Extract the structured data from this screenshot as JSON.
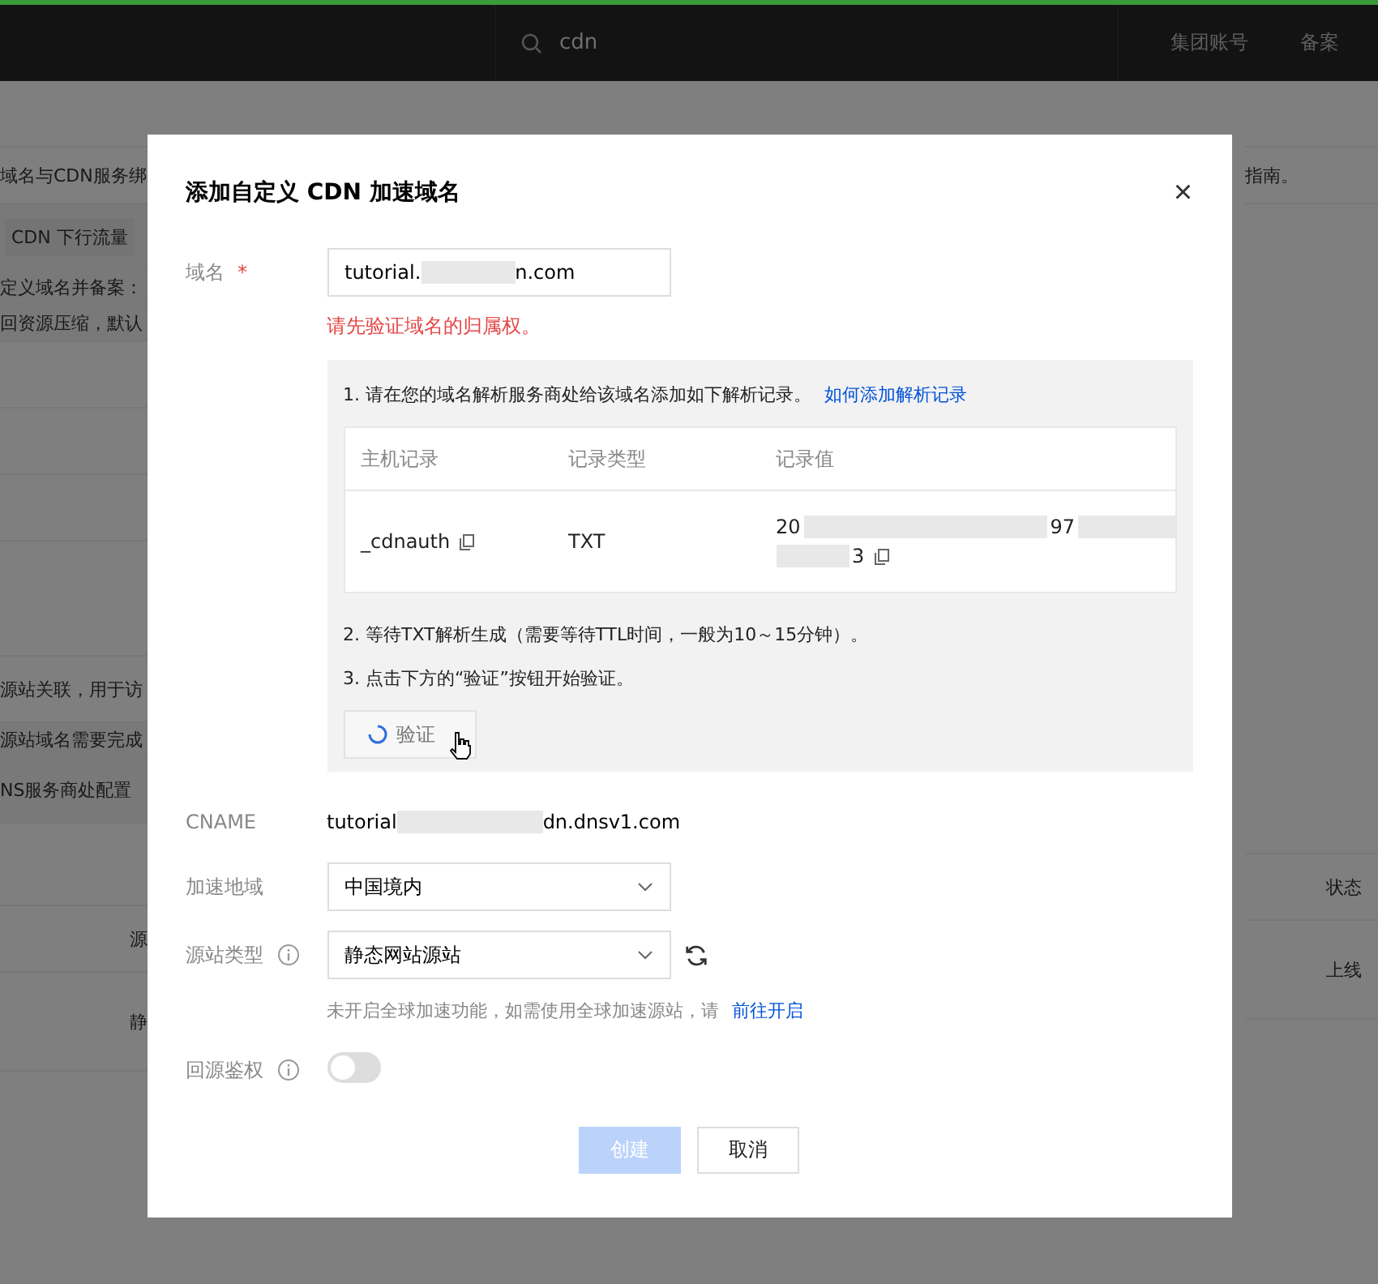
{
  "header": {
    "search_value": "cdn",
    "nav": [
      "集团账号",
      "备案"
    ]
  },
  "background": {
    "left": [
      "域名与CDN服务绑",
      "CDN 下行流量",
      "定义域名并备案：",
      "回资源压缩，默认",
      "源站关联，用于访",
      "源站域名需要完成",
      "NS服务商处配置",
      "源",
      "静"
    ],
    "right": [
      "指南。",
      "状态",
      "上线"
    ]
  },
  "dialog": {
    "title": "添加自定义 CDN 加速域名",
    "close": "×",
    "domain": {
      "label": "域名",
      "required_mark": "*",
      "value_start": "tutorial.",
      "value_end": "n.com",
      "error": "请先验证域名的归属权。"
    },
    "verify": {
      "step1": "1. 请在您的域名解析服务商处给该域名添加如下解析记录。",
      "help_link": "如何添加解析记录",
      "columns": [
        "主机记录",
        "记录类型",
        "记录值"
      ],
      "record": {
        "host": "_cdnauth",
        "type": "TXT",
        "value_start": "20",
        "value_mid": "97",
        "value_end": "3"
      },
      "step2": "2. 等待TXT解析生成（需要等待TTL时间，一般为10～15分钟）。",
      "step3": "3. 点击下方的“验证”按钮开始验证。",
      "button": {
        "label": "验证",
        "loading": true
      }
    },
    "cname": {
      "label": "CNAME",
      "value_start": "tutorial",
      "value_end": "dn.dnsv1.com"
    },
    "region": {
      "label": "加速地域",
      "value": "中国境内"
    },
    "origin": {
      "label": "源站类型",
      "value": "静态网站源站",
      "hint": "未开启全球加速功能，如需使用全球加速源站，请",
      "hint_link": "前往开启"
    },
    "auth": {
      "label": "回源鉴权",
      "checked": false
    },
    "buttons": [
      {
        "label": "创建",
        "kind": "primary",
        "disabled": true
      },
      {
        "label": "取消",
        "kind": "default",
        "disabled": false
      }
    ]
  }
}
